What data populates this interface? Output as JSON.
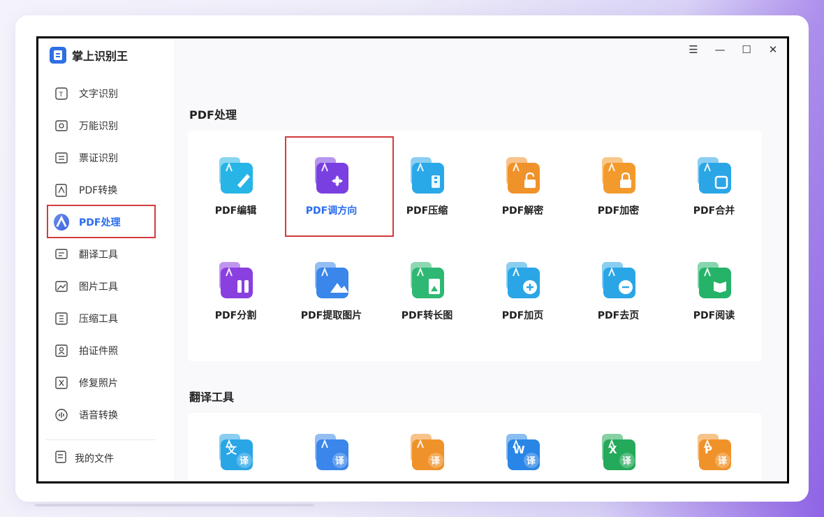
{
  "app": {
    "title": "掌上识别王"
  },
  "sidebar": {
    "items": [
      {
        "label": "文字识别",
        "icon": "text-ocr-icon"
      },
      {
        "label": "万能识别",
        "icon": "scan-search-icon"
      },
      {
        "label": "票证识别",
        "icon": "ticket-icon"
      },
      {
        "label": "PDF转换",
        "icon": "pdf-convert-icon"
      },
      {
        "label": "PDF处理",
        "icon": "pdf-process-icon",
        "active": true
      },
      {
        "label": "翻译工具",
        "icon": "translate-icon"
      },
      {
        "label": "图片工具",
        "icon": "image-icon"
      },
      {
        "label": "压缩工具",
        "icon": "compress-icon"
      },
      {
        "label": "拍证件照",
        "icon": "id-photo-icon"
      },
      {
        "label": "修复照片",
        "icon": "repair-photo-icon"
      },
      {
        "label": "语音转换",
        "icon": "voice-icon"
      }
    ],
    "myfiles": "我的文件"
  },
  "window_controls": [
    "menu-icon",
    "minimize-icon",
    "maximize-icon",
    "close-icon"
  ],
  "sections": {
    "pdf": {
      "title": "PDF处理",
      "tools": [
        {
          "label": "PDF编辑",
          "icon": "pdf-edit-icon",
          "color": "#27b4e6"
        },
        {
          "label": "PDF调方向",
          "icon": "pdf-rotate-icon",
          "color": "#7a3fe0",
          "selected": true
        },
        {
          "label": "PDF压缩",
          "icon": "pdf-compress-icon",
          "color": "#2ba8e8"
        },
        {
          "label": "PDF解密",
          "icon": "pdf-decrypt-icon",
          "color": "#f0922a"
        },
        {
          "label": "PDF加密",
          "icon": "pdf-encrypt-icon",
          "color": "#f39a2c"
        },
        {
          "label": "PDF合并",
          "icon": "pdf-merge-icon",
          "color": "#2aa6e6"
        },
        {
          "label": "PDF分割",
          "icon": "pdf-split-icon",
          "color": "#8a3fe0"
        },
        {
          "label": "PDF提取图片",
          "icon": "pdf-extract-image-icon",
          "color": "#3a86ea"
        },
        {
          "label": "PDF转长图",
          "icon": "pdf-long-image-icon",
          "color": "#2fb873"
        },
        {
          "label": "PDF加页",
          "icon": "pdf-add-page-icon",
          "color": "#2aa6e6"
        },
        {
          "label": "PDF去页",
          "icon": "pdf-remove-page-icon",
          "color": "#2aa6e6"
        },
        {
          "label": "PDF阅读",
          "icon": "pdf-read-icon",
          "color": "#25b36a"
        }
      ]
    },
    "translate": {
      "title": "翻译工具",
      "tools": [
        {
          "icon": "text-translate-icon",
          "color": "#2aa6e6",
          "glyph": "文"
        },
        {
          "icon": "image-translate-icon",
          "color": "#3a86ea",
          "glyph": ""
        },
        {
          "icon": "pdf-translate-icon",
          "color": "#f0922a",
          "glyph": ""
        },
        {
          "icon": "word-translate-icon",
          "color": "#2a86e6",
          "glyph": "W"
        },
        {
          "icon": "excel-translate-icon",
          "color": "#25a95a",
          "glyph": "X"
        },
        {
          "icon": "ppt-translate-icon",
          "color": "#f0922a",
          "glyph": "P"
        }
      ],
      "badge": "译"
    }
  }
}
